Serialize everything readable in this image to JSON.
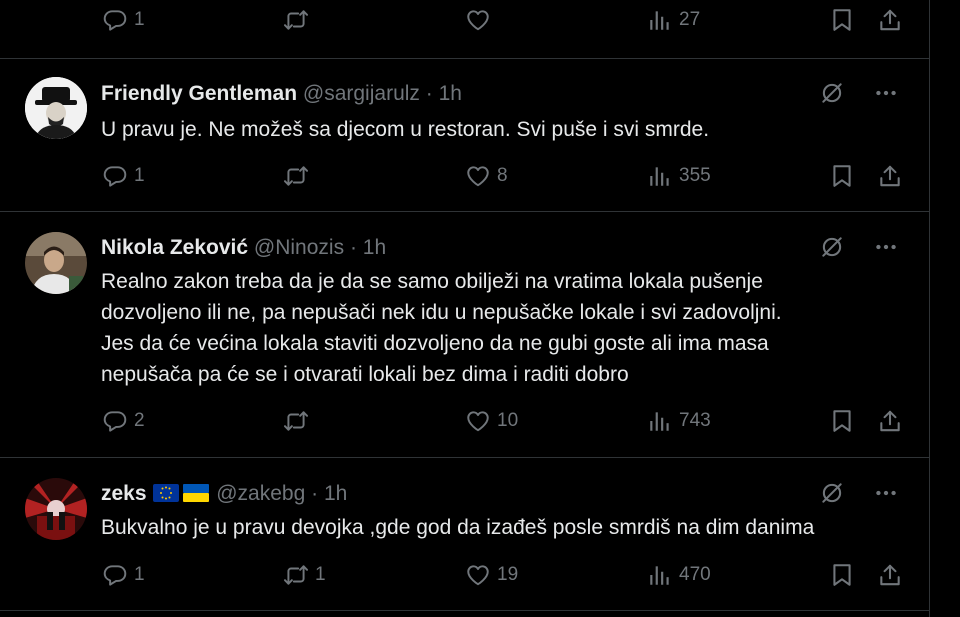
{
  "top_actions": {
    "replies": "1",
    "retweets": "",
    "likes": "",
    "views": "27"
  },
  "tweets": [
    {
      "name": "Friendly Gentleman",
      "handle": "@sargijarulz",
      "sep": "·",
      "time": "1h",
      "text": [
        "U pravu je. Ne možeš sa djecom u restoran. Svi puše i svi smrde."
      ],
      "replies": "1",
      "retweets": "",
      "likes": "8",
      "views": "355"
    },
    {
      "name": "Nikola Zeković",
      "handle": "@Ninozis",
      "sep": "·",
      "time": "1h",
      "text": [
        "Realno zakon treba da je da se samo obilježi na vratima lokala pušenje",
        "dozvoljeno ili ne, pa nepušači nek idu u nepušačke lokale i svi zadovoljni.",
        "Jes da će većina lokala staviti dozvoljeno da ne gubi goste ali ima masa",
        "nepušača pa će se i otvarati lokali bez dima i raditi dobro"
      ],
      "replies": "2",
      "retweets": "",
      "likes": "10",
      "views": "743"
    },
    {
      "name": "zeks",
      "handle": "@zakebg",
      "sep": "·",
      "time": "1h",
      "text": [
        "Bukvalno je u pravu devojka ,gde god da izađeš posle smrdiš na dim danima"
      ],
      "replies": "1",
      "retweets": "1",
      "likes": "19",
      "views": "470"
    }
  ],
  "colors": {
    "background": "#000000",
    "text": "#e7e9ea",
    "muted": "#71767b",
    "border": "#2f3336",
    "eu_blue": "#003399",
    "eu_star": "#ffcc00",
    "ua_blue": "#0057b7",
    "ua_yellow": "#ffd700"
  }
}
